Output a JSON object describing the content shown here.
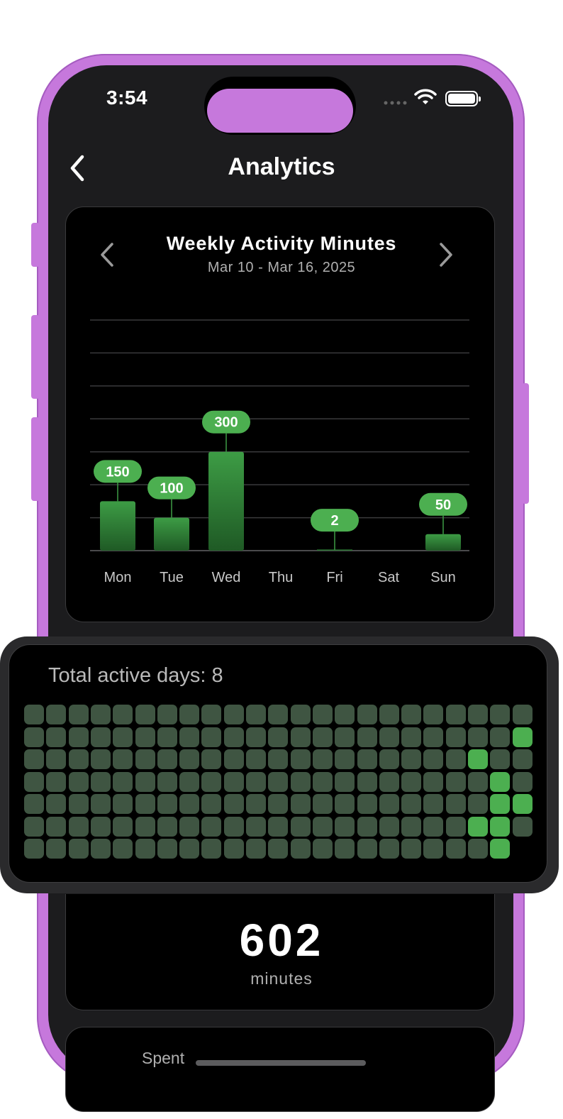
{
  "status_bar": {
    "time": "3:54"
  },
  "header": {
    "title": "Analytics"
  },
  "weekly_chart": {
    "title": "Weekly Activity Minutes",
    "date_range": "Mar 10 - Mar 16, 2025"
  },
  "chart_data": {
    "type": "bar",
    "categories": [
      "Mon",
      "Tue",
      "Wed",
      "Thu",
      "Fri",
      "Sat",
      "Sun"
    ],
    "values": [
      150,
      100,
      300,
      0,
      2,
      0,
      50
    ],
    "value_labels": [
      "150",
      "100",
      "300",
      "",
      "2",
      "",
      "50"
    ],
    "ylim": [
      0,
      700
    ],
    "grid": true,
    "colors": {
      "bar_top": "#3d9c45",
      "bar_bottom": "#1f5a25",
      "label_bg": "#4caf50",
      "grid": "#3a3a3c"
    }
  },
  "heatmap": {
    "title": "Total active days: 8",
    "columns": 23,
    "rows": 7,
    "active_cells": [
      [
        22,
        1
      ],
      [
        20,
        2
      ],
      [
        21,
        3
      ],
      [
        21,
        4
      ],
      [
        22,
        4
      ],
      [
        20,
        5
      ],
      [
        21,
        5
      ],
      [
        21,
        6
      ]
    ],
    "last_column_rows": 6,
    "colors": {
      "inactive": "#3f5542",
      "active": "#4caf50"
    }
  },
  "total": {
    "value": "602",
    "unit": "minutes"
  },
  "next_card": {
    "label": "Spent"
  },
  "colors": {
    "shell": "#c678dc",
    "screen": "#1c1c1e",
    "card": "#000000"
  }
}
